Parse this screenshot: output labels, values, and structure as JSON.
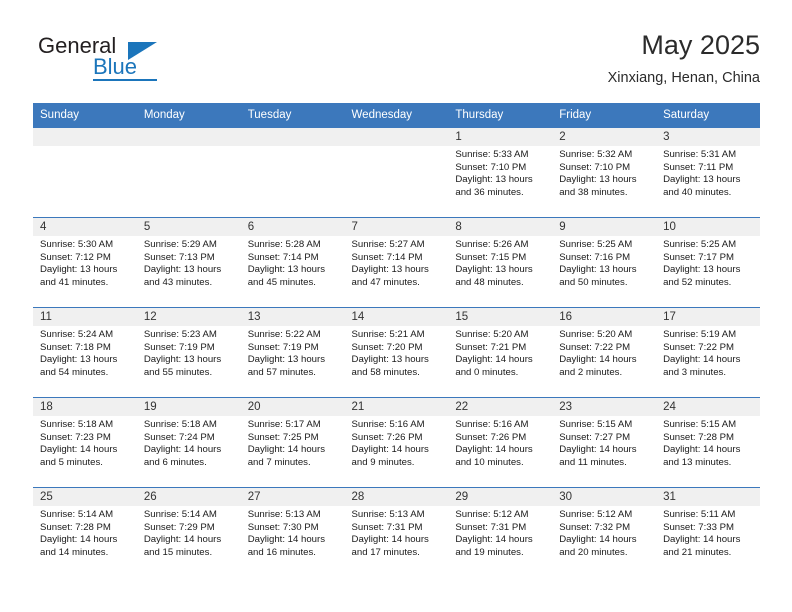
{
  "logo": {
    "word_general": "General",
    "word_blue": "Blue",
    "accent_color": "#1b75bb"
  },
  "header": {
    "title": "May 2025",
    "subtitle": "Xinxiang, Henan, China",
    "header_bg_color": "#3c78bc",
    "daynum_band_color": "#f0f0f0"
  },
  "weekday_headers": [
    "Sunday",
    "Monday",
    "Tuesday",
    "Wednesday",
    "Thursday",
    "Friday",
    "Saturday"
  ],
  "labels": {
    "sunrise_prefix": "Sunrise:",
    "sunset_prefix": "Sunset:",
    "daylight_prefix": "Daylight:"
  },
  "weeks": [
    [
      {
        "day": "",
        "sunrise": "",
        "sunset": "",
        "daylight_line1": "",
        "daylight_line2": "",
        "empty": true
      },
      {
        "day": "",
        "sunrise": "",
        "sunset": "",
        "daylight_line1": "",
        "daylight_line2": "",
        "empty": true
      },
      {
        "day": "",
        "sunrise": "",
        "sunset": "",
        "daylight_line1": "",
        "daylight_line2": "",
        "empty": true
      },
      {
        "day": "",
        "sunrise": "",
        "sunset": "",
        "daylight_line1": "",
        "daylight_line2": "",
        "empty": true
      },
      {
        "day": "1",
        "sunrise": "Sunrise: 5:33 AM",
        "sunset": "Sunset: 7:10 PM",
        "daylight_line1": "Daylight: 13 hours",
        "daylight_line2": "and 36 minutes.",
        "empty": false
      },
      {
        "day": "2",
        "sunrise": "Sunrise: 5:32 AM",
        "sunset": "Sunset: 7:10 PM",
        "daylight_line1": "Daylight: 13 hours",
        "daylight_line2": "and 38 minutes.",
        "empty": false
      },
      {
        "day": "3",
        "sunrise": "Sunrise: 5:31 AM",
        "sunset": "Sunset: 7:11 PM",
        "daylight_line1": "Daylight: 13 hours",
        "daylight_line2": "and 40 minutes.",
        "empty": false
      }
    ],
    [
      {
        "day": "4",
        "sunrise": "Sunrise: 5:30 AM",
        "sunset": "Sunset: 7:12 PM",
        "daylight_line1": "Daylight: 13 hours",
        "daylight_line2": "and 41 minutes.",
        "empty": false
      },
      {
        "day": "5",
        "sunrise": "Sunrise: 5:29 AM",
        "sunset": "Sunset: 7:13 PM",
        "daylight_line1": "Daylight: 13 hours",
        "daylight_line2": "and 43 minutes.",
        "empty": false
      },
      {
        "day": "6",
        "sunrise": "Sunrise: 5:28 AM",
        "sunset": "Sunset: 7:14 PM",
        "daylight_line1": "Daylight: 13 hours",
        "daylight_line2": "and 45 minutes.",
        "empty": false
      },
      {
        "day": "7",
        "sunrise": "Sunrise: 5:27 AM",
        "sunset": "Sunset: 7:14 PM",
        "daylight_line1": "Daylight: 13 hours",
        "daylight_line2": "and 47 minutes.",
        "empty": false
      },
      {
        "day": "8",
        "sunrise": "Sunrise: 5:26 AM",
        "sunset": "Sunset: 7:15 PM",
        "daylight_line1": "Daylight: 13 hours",
        "daylight_line2": "and 48 minutes.",
        "empty": false
      },
      {
        "day": "9",
        "sunrise": "Sunrise: 5:25 AM",
        "sunset": "Sunset: 7:16 PM",
        "daylight_line1": "Daylight: 13 hours",
        "daylight_line2": "and 50 minutes.",
        "empty": false
      },
      {
        "day": "10",
        "sunrise": "Sunrise: 5:25 AM",
        "sunset": "Sunset: 7:17 PM",
        "daylight_line1": "Daylight: 13 hours",
        "daylight_line2": "and 52 minutes.",
        "empty": false
      }
    ],
    [
      {
        "day": "11",
        "sunrise": "Sunrise: 5:24 AM",
        "sunset": "Sunset: 7:18 PM",
        "daylight_line1": "Daylight: 13 hours",
        "daylight_line2": "and 54 minutes.",
        "empty": false
      },
      {
        "day": "12",
        "sunrise": "Sunrise: 5:23 AM",
        "sunset": "Sunset: 7:19 PM",
        "daylight_line1": "Daylight: 13 hours",
        "daylight_line2": "and 55 minutes.",
        "empty": false
      },
      {
        "day": "13",
        "sunrise": "Sunrise: 5:22 AM",
        "sunset": "Sunset: 7:19 PM",
        "daylight_line1": "Daylight: 13 hours",
        "daylight_line2": "and 57 minutes.",
        "empty": false
      },
      {
        "day": "14",
        "sunrise": "Sunrise: 5:21 AM",
        "sunset": "Sunset: 7:20 PM",
        "daylight_line1": "Daylight: 13 hours",
        "daylight_line2": "and 58 minutes.",
        "empty": false
      },
      {
        "day": "15",
        "sunrise": "Sunrise: 5:20 AM",
        "sunset": "Sunset: 7:21 PM",
        "daylight_line1": "Daylight: 14 hours",
        "daylight_line2": "and 0 minutes.",
        "empty": false
      },
      {
        "day": "16",
        "sunrise": "Sunrise: 5:20 AM",
        "sunset": "Sunset: 7:22 PM",
        "daylight_line1": "Daylight: 14 hours",
        "daylight_line2": "and 2 minutes.",
        "empty": false
      },
      {
        "day": "17",
        "sunrise": "Sunrise: 5:19 AM",
        "sunset": "Sunset: 7:22 PM",
        "daylight_line1": "Daylight: 14 hours",
        "daylight_line2": "and 3 minutes.",
        "empty": false
      }
    ],
    [
      {
        "day": "18",
        "sunrise": "Sunrise: 5:18 AM",
        "sunset": "Sunset: 7:23 PM",
        "daylight_line1": "Daylight: 14 hours",
        "daylight_line2": "and 5 minutes.",
        "empty": false
      },
      {
        "day": "19",
        "sunrise": "Sunrise: 5:18 AM",
        "sunset": "Sunset: 7:24 PM",
        "daylight_line1": "Daylight: 14 hours",
        "daylight_line2": "and 6 minutes.",
        "empty": false
      },
      {
        "day": "20",
        "sunrise": "Sunrise: 5:17 AM",
        "sunset": "Sunset: 7:25 PM",
        "daylight_line1": "Daylight: 14 hours",
        "daylight_line2": "and 7 minutes.",
        "empty": false
      },
      {
        "day": "21",
        "sunrise": "Sunrise: 5:16 AM",
        "sunset": "Sunset: 7:26 PM",
        "daylight_line1": "Daylight: 14 hours",
        "daylight_line2": "and 9 minutes.",
        "empty": false
      },
      {
        "day": "22",
        "sunrise": "Sunrise: 5:16 AM",
        "sunset": "Sunset: 7:26 PM",
        "daylight_line1": "Daylight: 14 hours",
        "daylight_line2": "and 10 minutes.",
        "empty": false
      },
      {
        "day": "23",
        "sunrise": "Sunrise: 5:15 AM",
        "sunset": "Sunset: 7:27 PM",
        "daylight_line1": "Daylight: 14 hours",
        "daylight_line2": "and 11 minutes.",
        "empty": false
      },
      {
        "day": "24",
        "sunrise": "Sunrise: 5:15 AM",
        "sunset": "Sunset: 7:28 PM",
        "daylight_line1": "Daylight: 14 hours",
        "daylight_line2": "and 13 minutes.",
        "empty": false
      }
    ],
    [
      {
        "day": "25",
        "sunrise": "Sunrise: 5:14 AM",
        "sunset": "Sunset: 7:28 PM",
        "daylight_line1": "Daylight: 14 hours",
        "daylight_line2": "and 14 minutes.",
        "empty": false
      },
      {
        "day": "26",
        "sunrise": "Sunrise: 5:14 AM",
        "sunset": "Sunset: 7:29 PM",
        "daylight_line1": "Daylight: 14 hours",
        "daylight_line2": "and 15 minutes.",
        "empty": false
      },
      {
        "day": "27",
        "sunrise": "Sunrise: 5:13 AM",
        "sunset": "Sunset: 7:30 PM",
        "daylight_line1": "Daylight: 14 hours",
        "daylight_line2": "and 16 minutes.",
        "empty": false
      },
      {
        "day": "28",
        "sunrise": "Sunrise: 5:13 AM",
        "sunset": "Sunset: 7:31 PM",
        "daylight_line1": "Daylight: 14 hours",
        "daylight_line2": "and 17 minutes.",
        "empty": false
      },
      {
        "day": "29",
        "sunrise": "Sunrise: 5:12 AM",
        "sunset": "Sunset: 7:31 PM",
        "daylight_line1": "Daylight: 14 hours",
        "daylight_line2": "and 19 minutes.",
        "empty": false
      },
      {
        "day": "30",
        "sunrise": "Sunrise: 5:12 AM",
        "sunset": "Sunset: 7:32 PM",
        "daylight_line1": "Daylight: 14 hours",
        "daylight_line2": "and 20 minutes.",
        "empty": false
      },
      {
        "day": "31",
        "sunrise": "Sunrise: 5:11 AM",
        "sunset": "Sunset: 7:33 PM",
        "daylight_line1": "Daylight: 14 hours",
        "daylight_line2": "and 21 minutes.",
        "empty": false
      }
    ]
  ]
}
